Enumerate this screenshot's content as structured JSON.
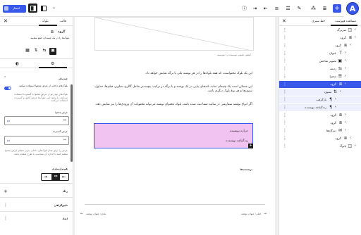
{
  "topbar": {
    "publish_label": "انتشار",
    "logo_letter": "A",
    "icons": [
      "add-block-icon",
      "undo-icon",
      "redo-icon",
      "details-icon",
      "settings-icon",
      "sidebar-icon",
      "view-icon",
      "list-view-icon",
      "block-tools-icon"
    ]
  },
  "left_panel": {
    "tab_block": "بلوک",
    "tab_post": "قالب",
    "block_title": "گروه",
    "block_desc": "بلوک‌ها را در یک چینه‌دان جمع بنمایید.",
    "settings": {
      "layout_heading": "چیدمان",
      "toggle_label": "بلوک‌های داخلی از عرض محتوا استفاده میکنند.",
      "toggle_help": "بلوک‌های تودر تو از عرض محتوا یا گسترده استفاده می‌کنند. با وجود این، بلوک‌ها عرض کامل و گسترده استفاده می‌کنند.",
      "content_width_label": "عرض محتوا",
      "content_width_value": "px",
      "wide_width_label": "عرض گسترده",
      "wide_width_value": "px",
      "help_text": "عرض را برای تمام بلوک‌های داخلی بدون تنظیم عرض محتوا تنظیم کنید تا اندازه آن متناسب با طرح صفحه باشد.",
      "justification_label": "هم‌ترازسازی",
      "color_section": "رنگ",
      "typography_section": "تایپوگرافی",
      "dimensions_section": "ابعاد"
    }
  },
  "editor": {
    "image_caption": "کپشن تصویر نویسنده را بنویسید",
    "paragraph_1": "این یک بلوک محتواست، که همه بلوک‌ها را در هر نوشته تکی یا برگه نمایش خواهد داد.",
    "paragraph_2": "این مسکن است یک چینمان ساده بلندهای پیاپی در یک نوشته و یا برگه در ترکیب پیچیده‌تر شامل گالری تصاویر، فیلم‌ها، جداول، ستون‌ها و هر نوع بلوک دیگری باشد.",
    "paragraph_3": "اگر انواع نوشته سفارشی در سایت شما ثبت شده باشد، بلوک محتوای نوشته می‌تواند محتویات آن ورودی‌ها را نیز نمایش دهد.",
    "group_lines": [
      "درباره نویسنده",
      "زندگینامه نویسنده"
    ],
    "tags_label": "برچسب‌ها",
    "prev_link": "قبلی: عنوان نوشته",
    "next_link": "بعدی: عنوان نوشته"
  },
  "list_view": {
    "tab_list": "مشاهده فهرست",
    "tab_outline": "خط سیری",
    "items": [
      {
        "label": "سربرگ",
        "icon": "template-part-icon",
        "indent": 0,
        "state": "normal"
      },
      {
        "label": "گروه",
        "icon": "group-icon",
        "indent": 0,
        "state": "normal"
      },
      {
        "label": "گروه",
        "icon": "group-icon",
        "indent": 1,
        "state": "normal"
      },
      {
        "label": "عنوان",
        "icon": "heading-icon",
        "indent": 2,
        "state": "normal"
      },
      {
        "label": "تصویر شاخص",
        "icon": "image-icon",
        "indent": 2,
        "state": "normal"
      },
      {
        "label": "ردیف",
        "icon": "row-icon",
        "indent": 2,
        "state": "normal"
      },
      {
        "label": "محتوا",
        "icon": "content-icon",
        "indent": 2,
        "state": "normal"
      },
      {
        "label": "گروه",
        "icon": "group-icon",
        "indent": 2,
        "state": "selected"
      },
      {
        "label": "ستون",
        "icon": "stack-icon",
        "indent": 3,
        "state": "sub"
      },
      {
        "label": "بازگرفت",
        "icon": "paragraph-icon",
        "indent": 4,
        "state": "sub"
      },
      {
        "label": "زندگینامه نویسنده",
        "icon": "paragraph-icon",
        "indent": 4,
        "state": "sub"
      },
      {
        "label": "گروه",
        "icon": "group-icon",
        "indent": 2,
        "state": "normal"
      },
      {
        "label": "گروه",
        "icon": "group-icon",
        "indent": 2,
        "state": "normal"
      },
      {
        "label": "دیدگاه‌ها",
        "icon": "comments-icon",
        "indent": 2,
        "state": "normal"
      },
      {
        "label": "گروه",
        "icon": "group-icon",
        "indent": 1,
        "state": "normal"
      },
      {
        "label": "پانوگ",
        "icon": "template-part-icon",
        "indent": 0,
        "state": "normal"
      }
    ]
  },
  "colors": {
    "accent": "#3858e9",
    "group_background": "#f1c3f0",
    "toggle_on": "#3858e9"
  }
}
